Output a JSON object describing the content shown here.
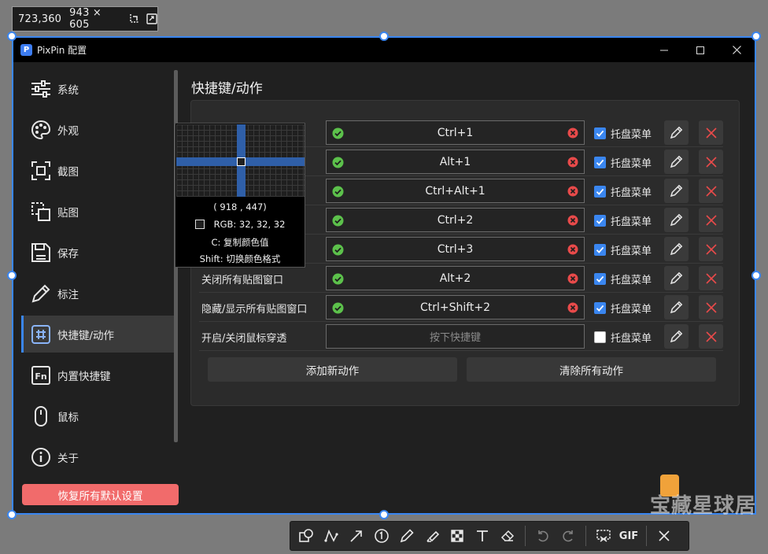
{
  "capture_info": {
    "position": "723,360",
    "size": "943 × 605"
  },
  "window": {
    "logo_letter": "P",
    "title": "PixPin 配置"
  },
  "sidebar": {
    "items": [
      {
        "label": "系统",
        "icon": "sliders-icon"
      },
      {
        "label": "外观",
        "icon": "palette-icon"
      },
      {
        "label": "截图",
        "icon": "screenshot-icon"
      },
      {
        "label": "贴图",
        "icon": "pin-image-icon"
      },
      {
        "label": "保存",
        "icon": "save-icon"
      },
      {
        "label": "标注",
        "icon": "pencil-icon"
      },
      {
        "label": "快捷键/动作",
        "icon": "hash-icon",
        "active": true
      },
      {
        "label": "内置快捷键",
        "icon": "fn-key-icon"
      },
      {
        "label": "鼠标",
        "icon": "mouse-icon"
      },
      {
        "label": "关于",
        "icon": "info-icon"
      }
    ],
    "reset_label": "恢复所有默认设置"
  },
  "main": {
    "title": "快捷键/动作",
    "rows": [
      {
        "label": "",
        "shortcut": "Ctrl+1",
        "tray": true
      },
      {
        "label": "",
        "shortcut": "Alt+1",
        "tray": true
      },
      {
        "label": "",
        "shortcut": "Ctrl+Alt+1",
        "tray": true
      },
      {
        "label": "",
        "shortcut": "Ctrl+2",
        "tray": true
      },
      {
        "label": "",
        "shortcut": "Ctrl+3",
        "tray": true
      },
      {
        "label": "关闭所有贴图窗口",
        "shortcut": "Alt+2",
        "tray": true
      },
      {
        "label": "隐藏/显示所有贴图窗口",
        "shortcut": "Ctrl+Shift+2",
        "tray": true
      },
      {
        "label": "开启/关闭鼠标穿透",
        "shortcut": "",
        "placeholder": "按下快捷键",
        "tray": false
      }
    ],
    "tray_label": "托盘菜单",
    "add_label": "添加新动作",
    "clear_label": "清除所有动作"
  },
  "magnifier": {
    "coords": "( 918 ,  447)",
    "rgb": "RGB:  32, 32, 32",
    "hint_copy": "C: 复制颜色值",
    "hint_switch": "Shift: 切换颜色格式"
  },
  "toolbar": {
    "gif_label": "GIF"
  },
  "watermark": {
    "text": "宝藏星球居"
  },
  "colors": {
    "accent": "#3a86f0",
    "reset_button": "#f16b6b",
    "ok_green": "#5cc14b",
    "clear_red": "#e84a4a"
  }
}
